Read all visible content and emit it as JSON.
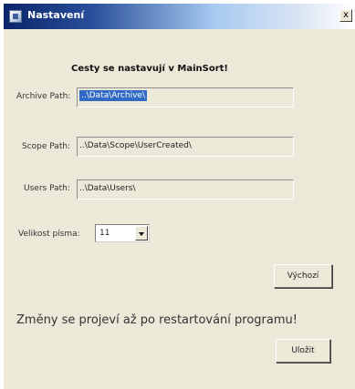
{
  "window": {
    "title": "Nastavení",
    "close_glyph": "x"
  },
  "heading": "Cesty se nastavují v MainSort!",
  "fields": [
    {
      "label": "Archive Path:",
      "value": "..\\Data\\Archive\\"
    },
    {
      "label": "Scope Path:",
      "value": "..\\Data\\Scope\\UserCreated\\"
    },
    {
      "label": "Users Path:",
      "value": "..\\Data\\Users\\"
    }
  ],
  "font_size": {
    "label": "Velikost písma:",
    "selected": "11"
  },
  "buttons": {
    "defaults_label": "Výchozí",
    "save_label": "Uložit"
  },
  "restart_note": "Změny se projeví až po restartování programu!",
  "colors": {
    "title_gradient_start": "#0a246a",
    "selection": "#316ac5",
    "window_face": "#ece9d8"
  },
  "icons": {
    "app": "window-app-icon",
    "close": "close-icon",
    "dropdown": "chevron-down-icon"
  }
}
